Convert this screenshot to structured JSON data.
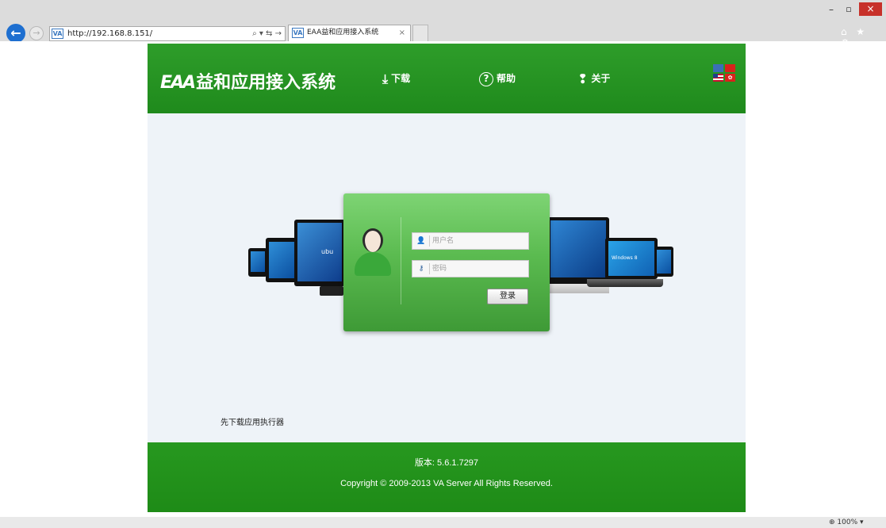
{
  "browser": {
    "url": "http://192.168.8.151/",
    "address_tools": "⌕ ▾ ⇆ →",
    "tab_title": "EAA益和应用接入系统",
    "tab_close": "×",
    "favicon": "VA",
    "window_controls": {
      "minimize": "–",
      "maximize": "▫",
      "close": "×"
    },
    "toolbar_icons": "⌂ ★ ⚙",
    "zoom": "100%"
  },
  "header": {
    "logo_mark": "EAA",
    "logo_text": "益和应用接入系统",
    "nav": [
      {
        "label": "下载",
        "icon": "download-icon",
        "glyph": "⤓"
      },
      {
        "label": "帮助",
        "icon": "help-icon",
        "glyph": "?"
      },
      {
        "label": "关于",
        "icon": "about-icon",
        "glyph": "❢"
      }
    ],
    "flag_hk": "✿"
  },
  "login": {
    "username_placeholder": "用户名",
    "password_placeholder": "密码",
    "user_icon": "👤",
    "key_icon": "⚷",
    "submit_label": "登录"
  },
  "devices": {
    "ubuntu_label": "ubu",
    "windows_label": "Windows 8",
    "apple_logo": ""
  },
  "download_link": "先下载应用执行器",
  "footer": {
    "version": "版本: 5.6.1.7297",
    "copyright": "Copyright © 2009-2013 VA Server All Rights Reserved."
  },
  "colors": {
    "header_green": "#2e9d2a",
    "panel_green": "#5bbb50",
    "content_bg": "#eef3f8",
    "ie_close_red": "#c7312a",
    "ie_back_blue": "#1e6fd0"
  }
}
